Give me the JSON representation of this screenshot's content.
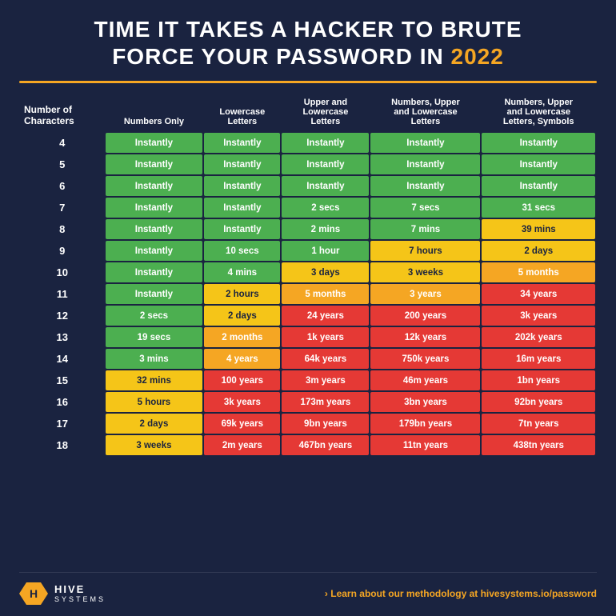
{
  "title": {
    "line1": "TIME IT TAKES A HACKER TO BRUTE",
    "line2_prefix": "FORCE YOUR PASSWORD IN ",
    "year": "2022"
  },
  "headers": [
    "Number of Characters",
    "Numbers Only",
    "Lowercase Letters",
    "Upper and Lowercase Letters",
    "Numbers, Upper and Lowercase Letters",
    "Numbers, Upper and Lowercase Letters, Symbols"
  ],
  "rows": [
    {
      "chars": "4",
      "c1": "Instantly",
      "c2": "Instantly",
      "c3": "Instantly",
      "c4": "Instantly",
      "c5": "Instantly",
      "col1": "green",
      "col2": "green",
      "col3": "green",
      "col4": "green",
      "col5": "green"
    },
    {
      "chars": "5",
      "c1": "Instantly",
      "c2": "Instantly",
      "c3": "Instantly",
      "c4": "Instantly",
      "c5": "Instantly",
      "col1": "green",
      "col2": "green",
      "col3": "green",
      "col4": "green",
      "col5": "green"
    },
    {
      "chars": "6",
      "c1": "Instantly",
      "c2": "Instantly",
      "c3": "Instantly",
      "c4": "Instantly",
      "c5": "Instantly",
      "col1": "green",
      "col2": "green",
      "col3": "green",
      "col4": "green",
      "col5": "green"
    },
    {
      "chars": "7",
      "c1": "Instantly",
      "c2": "Instantly",
      "c3": "2 secs",
      "c4": "7 secs",
      "c5": "31 secs",
      "col1": "green",
      "col2": "green",
      "col3": "green",
      "col4": "green",
      "col5": "green"
    },
    {
      "chars": "8",
      "c1": "Instantly",
      "c2": "Instantly",
      "c3": "2 mins",
      "c4": "7 mins",
      "c5": "39 mins",
      "col1": "green",
      "col2": "green",
      "col3": "green",
      "col4": "green",
      "col5": "yellow"
    },
    {
      "chars": "9",
      "c1": "Instantly",
      "c2": "10 secs",
      "c3": "1 hour",
      "c4": "7 hours",
      "c5": "2 days",
      "col1": "green",
      "col2": "green",
      "col3": "green",
      "col4": "yellow",
      "col5": "yellow"
    },
    {
      "chars": "10",
      "c1": "Instantly",
      "c2": "4 mins",
      "c3": "3 days",
      "c4": "3 weeks",
      "c5": "5 months",
      "col1": "green",
      "col2": "green",
      "col3": "yellow",
      "col4": "yellow",
      "col5": "orange"
    },
    {
      "chars": "11",
      "c1": "Instantly",
      "c2": "2 hours",
      "c3": "5 months",
      "c4": "3 years",
      "c5": "34 years",
      "col1": "green",
      "col2": "yellow",
      "col3": "orange",
      "col4": "orange",
      "col5": "red"
    },
    {
      "chars": "12",
      "c1": "2 secs",
      "c2": "2 days",
      "c3": "24 years",
      "c4": "200 years",
      "c5": "3k years",
      "col1": "green",
      "col2": "yellow",
      "col3": "red",
      "col4": "red",
      "col5": "red"
    },
    {
      "chars": "13",
      "c1": "19 secs",
      "c2": "2 months",
      "c3": "1k years",
      "c4": "12k years",
      "c5": "202k years",
      "col1": "green",
      "col2": "orange",
      "col3": "red",
      "col4": "red",
      "col5": "red"
    },
    {
      "chars": "14",
      "c1": "3 mins",
      "c2": "4 years",
      "c3": "64k years",
      "c4": "750k years",
      "c5": "16m years",
      "col1": "green",
      "col2": "orange",
      "col3": "red",
      "col4": "red",
      "col5": "red"
    },
    {
      "chars": "15",
      "c1": "32 mins",
      "c2": "100 years",
      "c3": "3m years",
      "c4": "46m years",
      "c5": "1bn years",
      "col1": "yellow",
      "col2": "red",
      "col3": "red",
      "col4": "red",
      "col5": "red"
    },
    {
      "chars": "16",
      "c1": "5 hours",
      "c2": "3k years",
      "c3": "173m years",
      "c4": "3bn years",
      "c5": "92bn years",
      "col1": "yellow",
      "col2": "red",
      "col3": "red",
      "col4": "red",
      "col5": "red"
    },
    {
      "chars": "17",
      "c1": "2 days",
      "c2": "69k years",
      "c3": "9bn years",
      "c4": "179bn years",
      "c5": "7tn years",
      "col1": "yellow",
      "col2": "red",
      "col3": "red",
      "col4": "red",
      "col5": "red"
    },
    {
      "chars": "18",
      "c1": "3 weeks",
      "c2": "2m years",
      "c3": "467bn years",
      "c4": "11tn years",
      "c5": "438tn years",
      "col1": "yellow",
      "col2": "red",
      "col3": "red",
      "col4": "red",
      "col5": "red"
    }
  ],
  "footer": {
    "logo_name": "HIVE",
    "logo_sub": "SYSTEMS",
    "link_prefix": "› Learn about our methodology at ",
    "link_url": "hivesystems.io/password"
  }
}
